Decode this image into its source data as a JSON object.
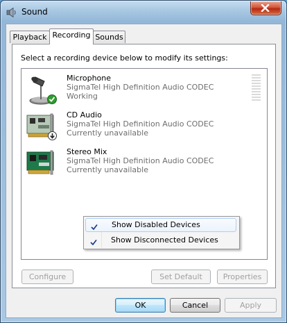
{
  "window": {
    "title": "Sound",
    "icon": "speaker-icon",
    "close_icon": "close-icon"
  },
  "tabs": [
    {
      "label": "Playback",
      "active": false
    },
    {
      "label": "Recording",
      "active": true
    },
    {
      "label": "Sounds",
      "active": false
    }
  ],
  "recording": {
    "instruction": "Select a recording device below to modify its settings:",
    "devices": [
      {
        "name": "Microphone",
        "driver": "SigmaTel High Definition Audio CODEC",
        "status": "Working",
        "icon": "microphone-icon",
        "status_icon": "green-check-icon",
        "level_meter": true
      },
      {
        "name": "CD Audio",
        "driver": "SigmaTel High Definition Audio CODEC",
        "status": "Currently unavailable",
        "icon": "sound-card-icon",
        "status_icon": "down-arrow-icon"
      },
      {
        "name": "Stereo Mix",
        "driver": "SigmaTel High Definition Audio CODEC",
        "status": "Currently unavailable",
        "icon": "sound-card-icon"
      }
    ],
    "context_menu": [
      {
        "label": "Show Disabled Devices",
        "checked": true,
        "highlighted": true
      },
      {
        "label": "Show Disconnected Devices",
        "checked": true,
        "highlighted": false
      }
    ],
    "buttons": {
      "configure": "Configure",
      "set_default": "Set Default",
      "properties": "Properties"
    }
  },
  "dialog_buttons": {
    "ok": "OK",
    "cancel": "Cancel",
    "apply": "Apply"
  },
  "colors": {
    "titlebar": "#a9c8e3",
    "close_button": "#c7422a",
    "secondary_text": "#6d6d6d",
    "check_green": "#2f9c2f",
    "check_blue": "#1a3a8a",
    "menu_highlight_border": "#aecff7"
  }
}
